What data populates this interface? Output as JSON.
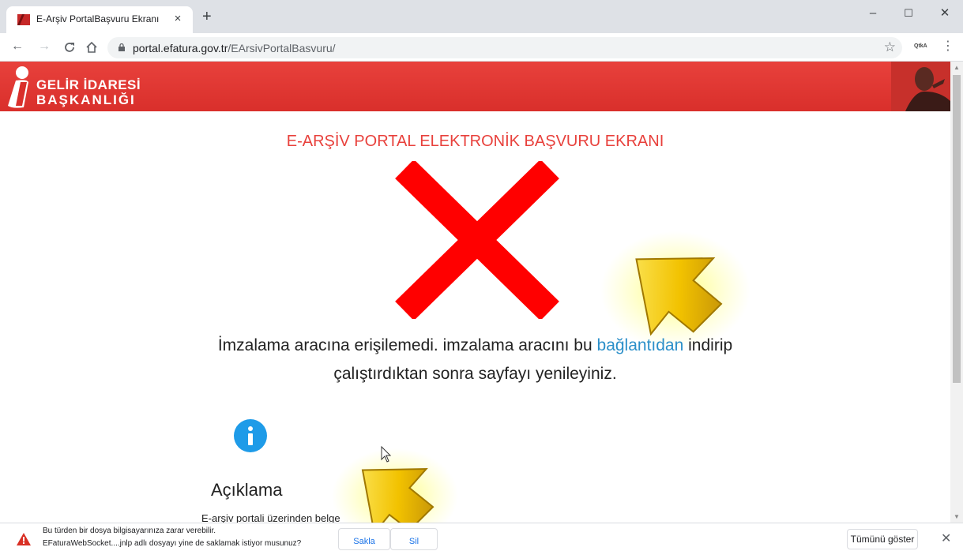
{
  "browser": {
    "tab_title": "E-Arşiv PortalBaşvuru Ekranı",
    "tab_close": "×",
    "new_tab": "+",
    "window_minimize": "–",
    "window_maximize": "☐",
    "window_close": "✕",
    "url_host": "portal.efatura.gov.tr",
    "url_path": "/EArsivPortalBasvuru/",
    "extension_label": "QtkA"
  },
  "header": {
    "logo_line1": "GELİR İDARESİ",
    "logo_line2": "BAŞKANLIĞI"
  },
  "main": {
    "title": "E-ARŞİV PORTAL ELEKTRONİK BAŞVURU EKRANI",
    "message_before_link": "İmzalama aracına erişilemedi. imzalama aracını bu ",
    "message_link": "bağlantıdan",
    "message_after_link": "  indirip",
    "message_line2": "çalıştırdıktan sonra sayfayı yenileyiniz.",
    "info_heading": "Açıklama",
    "info_text": "E-arşiv portali üzerinden belge"
  },
  "download_bar": {
    "warning_line1": "Bu türden bir dosya bilgisayarınıza zarar verebilir.",
    "warning_line2": "EFaturaWebSocket....jnlp adlı dosyayı yine de saklamak istiyor musunuz?",
    "keep_label": "Sakla",
    "delete_label": "Sil",
    "show_all_label": "Tümünü göster",
    "close": "✕"
  },
  "colors": {
    "brand_red": "#e8413c",
    "link_blue": "#2b8fc9",
    "info_blue": "#1e9be8",
    "error_x_red": "#ff0000"
  }
}
